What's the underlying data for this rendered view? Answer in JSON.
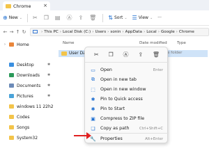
{
  "window": {
    "tab_title": "Chrome",
    "tab_close": "×"
  },
  "toolbar": {
    "new_label": "New",
    "sort_label": "Sort",
    "view_label": "View",
    "more_label": "···"
  },
  "address": {
    "crumbs": [
      "This PC",
      "Local Disk (C:)",
      "Users",
      "sonin",
      "AppData",
      "Local",
      "Google",
      "Chrome"
    ]
  },
  "sidebar": {
    "items": [
      {
        "label": "Home",
        "pinned": false,
        "expand": true
      },
      {
        "label": "Desktop",
        "pinned": true,
        "expand": false
      },
      {
        "label": "Downloads",
        "pinned": true,
        "expand": false
      },
      {
        "label": "Documents",
        "pinned": true,
        "expand": false
      },
      {
        "label": "Pictures",
        "pinned": true,
        "expand": false
      },
      {
        "label": "windows 11 22h2",
        "pinned": false,
        "expand": false
      },
      {
        "label": "Codes",
        "pinned": false,
        "expand": false
      },
      {
        "label": "Songs",
        "pinned": false,
        "expand": false
      },
      {
        "label": "System32",
        "pinned": false,
        "expand": false
      }
    ]
  },
  "content": {
    "col_name": "Name",
    "col_date": "Date modified",
    "col_type": "Type",
    "rows": [
      {
        "name": "User Data",
        "type": "File folder"
      }
    ]
  },
  "context_menu": {
    "top_icons": [
      "cut-icon",
      "copy-icon",
      "rename-icon",
      "share-icon",
      "delete-icon"
    ],
    "items": [
      {
        "label": "Open",
        "shortcut": "Enter"
      },
      {
        "label": "Open in new tab",
        "shortcut": ""
      },
      {
        "label": "Open in new window",
        "shortcut": ""
      },
      {
        "label": "Pin to Quick access",
        "shortcut": ""
      },
      {
        "label": "Pin to Start",
        "shortcut": ""
      },
      {
        "label": "Compress to ZIP file",
        "shortcut": ""
      },
      {
        "label": "Copy as path",
        "shortcut": "Ctrl+Shift+C"
      },
      {
        "label": "Properties",
        "shortcut": "Alt+Enter"
      }
    ]
  },
  "colors": {
    "accent": "#1f6fd1",
    "selection": "#cfe3f8",
    "folder": "#f3c44a",
    "annotation_arrow": "#e02020"
  }
}
